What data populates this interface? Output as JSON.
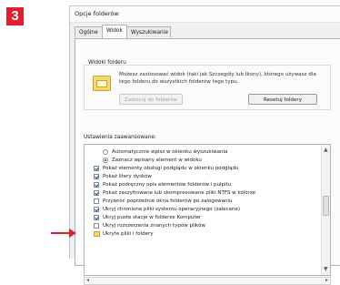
{
  "step_badge": "3",
  "dialog": {
    "title": "Opcje folderów",
    "tabs": [
      {
        "label": "Ogólne"
      },
      {
        "label": "Widok"
      },
      {
        "label": "Wyszukiwanie"
      }
    ],
    "active_tab": "Widok",
    "folder_views": {
      "label": "Widoki folderu",
      "description": "Możesz zastosować widok (taki jak Szczegóły lub Ikony), którego używasz dla tego folderu do wszystkich folderów tego typu.",
      "apply_button": "Zastosuj do folderów",
      "reset_button": "Resetuj foldery"
    },
    "advanced": {
      "label": "Ustawienia zaawansowane:",
      "items": [
        {
          "type": "radio",
          "checked": false,
          "indent": 1,
          "label": "Automatycznie wpisz w okienku wyszukiwania"
        },
        {
          "type": "radio",
          "checked": true,
          "indent": 1,
          "label": "Zaznacz wpisany element w widoku"
        },
        {
          "type": "checkbox",
          "checked": true,
          "indent": 0,
          "label": "Pokaż elementy obsługi podglądu w okienku podglądu"
        },
        {
          "type": "checkbox",
          "checked": true,
          "indent": 0,
          "label": "Pokaż litery dysków"
        },
        {
          "type": "checkbox",
          "checked": true,
          "indent": 0,
          "label": "Pokaż podręczny opis elementów folderów i pulpitu"
        },
        {
          "type": "checkbox",
          "checked": true,
          "indent": 0,
          "label": "Pokaż zaszyfrowane lub skompresowane pliki NTFS w kolorze"
        },
        {
          "type": "checkbox",
          "checked": false,
          "indent": 0,
          "label": "Przywróć poprzednie okna folderów po zalogowaniu"
        },
        {
          "type": "checkbox",
          "checked": true,
          "indent": 0,
          "label": "Ukryj chronione pliki systemu operacyjnego (zalecane)"
        },
        {
          "type": "checkbox",
          "checked": true,
          "indent": 0,
          "label": "Ukryj puste stacje w folderze Komputer"
        },
        {
          "type": "checkbox",
          "checked": false,
          "indent": 0,
          "label": "Ukryj rozszerzenia znanych typów plików"
        },
        {
          "type": "folder",
          "checked": false,
          "indent": 0,
          "label": "Ukryte pliki i foldery"
        }
      ]
    },
    "colors": {
      "badge": "#e2202b",
      "arrow": "#e2202b",
      "check": "#1b4fa0"
    }
  }
}
